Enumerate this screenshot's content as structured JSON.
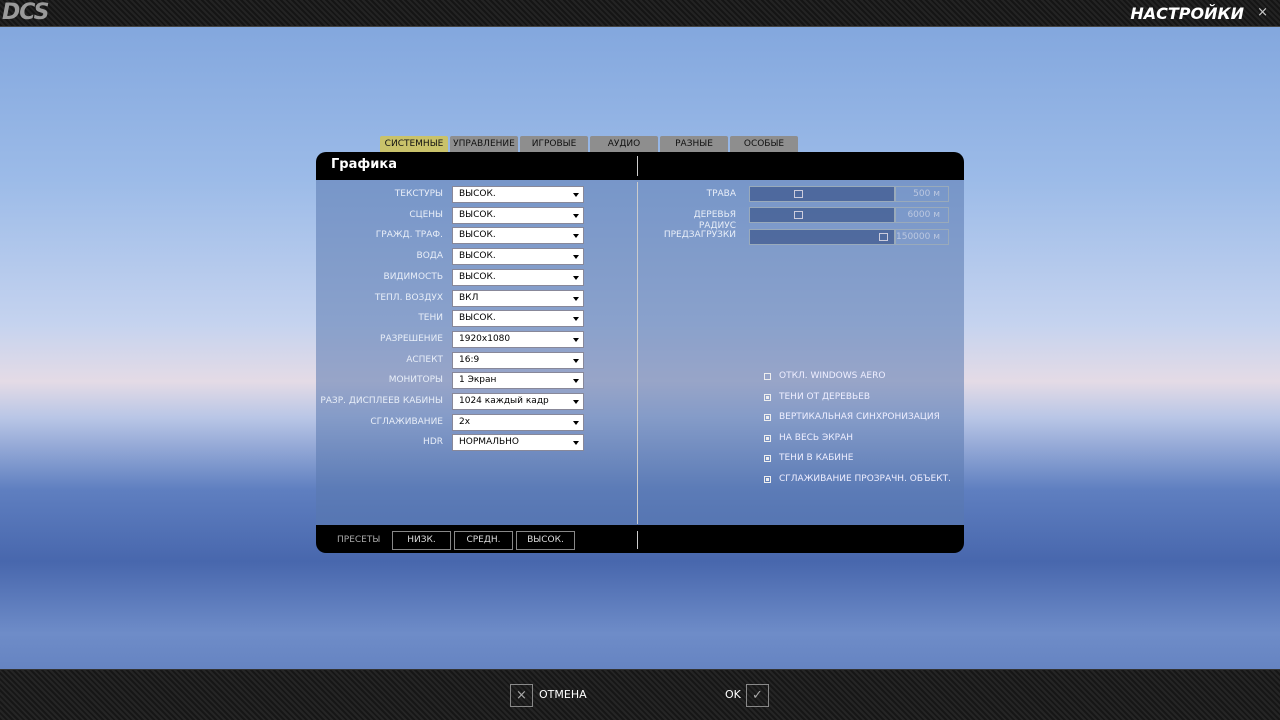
{
  "topbar": {
    "logo": "DCS",
    "title": "НАСТРОЙКИ",
    "close": "×"
  },
  "tabs": [
    {
      "label": "СИСТЕМНЫЕ",
      "active": true
    },
    {
      "label": "УПРАВЛЕНИЕ"
    },
    {
      "label": "ИГРОВЫЕ"
    },
    {
      "label": "АУДИО"
    },
    {
      "label": "РАЗНЫЕ"
    },
    {
      "label": "ОСОБЫЕ"
    }
  ],
  "panel": {
    "title": "Графика"
  },
  "settings": [
    {
      "label": "ТЕКСТУРЫ",
      "value": "ВЫСОК."
    },
    {
      "label": "СЦЕНЫ",
      "value": "ВЫСОК."
    },
    {
      "label": "ГРАЖД. ТРАФ.",
      "value": "ВЫСОК."
    },
    {
      "label": "ВОДА",
      "value": "ВЫСОК."
    },
    {
      "label": "ВИДИМОСТЬ",
      "value": "ВЫСОК."
    },
    {
      "label": "ТЕПЛ. ВОЗДУХ",
      "value": "ВКЛ"
    },
    {
      "label": "ТЕНИ",
      "value": "ВЫСОК."
    },
    {
      "label": "РАЗРЕШЕНИЕ",
      "value": "1920x1080"
    },
    {
      "label": "АСПЕКТ",
      "value": "16:9"
    },
    {
      "label": "МОНИТОРЫ",
      "value": "1 Экран"
    },
    {
      "label": "РАЗР. ДИСПЛЕЕВ КАБИНЫ",
      "value": "1024 каждый кадр"
    },
    {
      "label": "СГЛАЖИВАНИЕ",
      "value": "2x"
    },
    {
      "label": "HDR",
      "value": "НОРМАЛЬНО"
    }
  ],
  "sliders": [
    {
      "label": "ТРАВА",
      "value": "500 м",
      "level": 0.34
    },
    {
      "label": "ДЕРЕВЬЯ",
      "value": "6000 м",
      "level": 0.34
    },
    {
      "label": "РАДИУС ПРЕДЗАГРУЗКИ",
      "value": "150000 м",
      "level": 0.93
    }
  ],
  "checkboxes": [
    {
      "label": "ОТКЛ. WINDOWS AERO",
      "checked": false
    },
    {
      "label": "ТЕНИ ОТ ДЕРЕВЬЕВ",
      "checked": true
    },
    {
      "label": "ВЕРТИКАЛЬНАЯ СИНХРОНИЗАЦИЯ",
      "checked": true
    },
    {
      "label": "НА ВЕСЬ ЭКРАН",
      "checked": true
    },
    {
      "label": "ТЕНИ В КАБИНЕ",
      "checked": true
    },
    {
      "label": "СГЛАЖИВАНИЕ ПРОЗРАЧН. ОБЪЕКТ.",
      "checked": true
    }
  ],
  "presets": {
    "label": "ПРЕСЕТЫ",
    "buttons": [
      "НИЗК.",
      "СРЕДН.",
      "ВЫСОК."
    ]
  },
  "footer": {
    "cancel": "ОТМЕНА",
    "ok": "OK",
    "cancel_icon": "×",
    "ok_icon": "✓"
  }
}
